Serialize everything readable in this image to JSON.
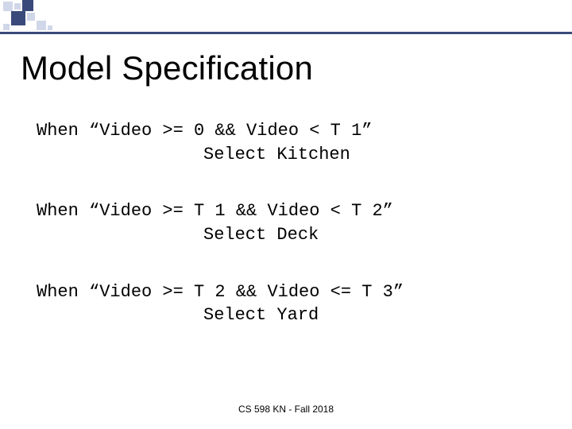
{
  "title": "Model Specification",
  "rules": [
    {
      "condition": "When “Video >= 0 && Video < T 1”",
      "action": "Select Kitchen"
    },
    {
      "condition": "When “Video >= T 1 && Video < T 2”",
      "action": "Select Deck"
    },
    {
      "condition": "When “Video >= T 2 && Video <= T 3”",
      "action": "Select Yard"
    }
  ],
  "footer": "CS 598 KN - Fall 2018"
}
